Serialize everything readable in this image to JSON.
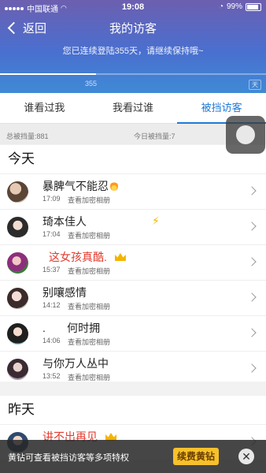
{
  "status_bar": {
    "carrier": "中国联通",
    "time": "19:08",
    "battery": "99%"
  },
  "nav": {
    "back_label": "返回",
    "title": "我的访客"
  },
  "banner": {
    "message": "您已连续登陆355天，请继续保持哦~",
    "streak_value": "355",
    "streak_progress": 0.36,
    "end_label": "天"
  },
  "tabs": [
    {
      "label": "谁看过我",
      "active": false
    },
    {
      "label": "我看过谁",
      "active": false
    },
    {
      "label": "被挡访客",
      "active": true
    }
  ],
  "stats": {
    "total": "总被挡量:881",
    "today": "今日被挡量:7"
  },
  "sections": [
    {
      "title": "今天",
      "rows": [
        {
          "name": "暴脾气不能忍",
          "time": "17:09",
          "subtext": "查看加密相册",
          "badge": "flame",
          "red": false
        },
        {
          "name": "琦本佳人",
          "time": "17:04",
          "subtext": "查看加密相册",
          "badge": "bolt",
          "red": false
        },
        {
          "name": "这女孩真酷.",
          "time": "15:37",
          "subtext": "查看加密相册",
          "badge": "crown",
          "red": true
        },
        {
          "name": "别嚷感情",
          "time": "14:12",
          "subtext": "查看加密相册",
          "badge": "",
          "red": false
        },
        {
          "name": ".       何时拥",
          "time": "14:06",
          "subtext": "查看加密相册",
          "badge": "",
          "red": false
        },
        {
          "name": "与你万人丛中",
          "time": "13:52",
          "subtext": "查看加密相册",
          "badge": "",
          "red": false
        }
      ]
    },
    {
      "title": "昨天",
      "rows": [
        {
          "name": "讲不出再见",
          "time": "",
          "subtext": "",
          "badge": "crown",
          "red": true
        }
      ]
    }
  ],
  "promo": {
    "text": "黄钻可查看被挡访客等多项特权",
    "button_label": "续费黄钻",
    "close_glyph": "✕"
  },
  "colors": {
    "accent": "#1f7ad8",
    "header_top": "#6c5fb0",
    "header_bottom": "#3f8ad6",
    "highlight_red": "#e23b2e",
    "vip_yellow": "#f6c12b"
  }
}
